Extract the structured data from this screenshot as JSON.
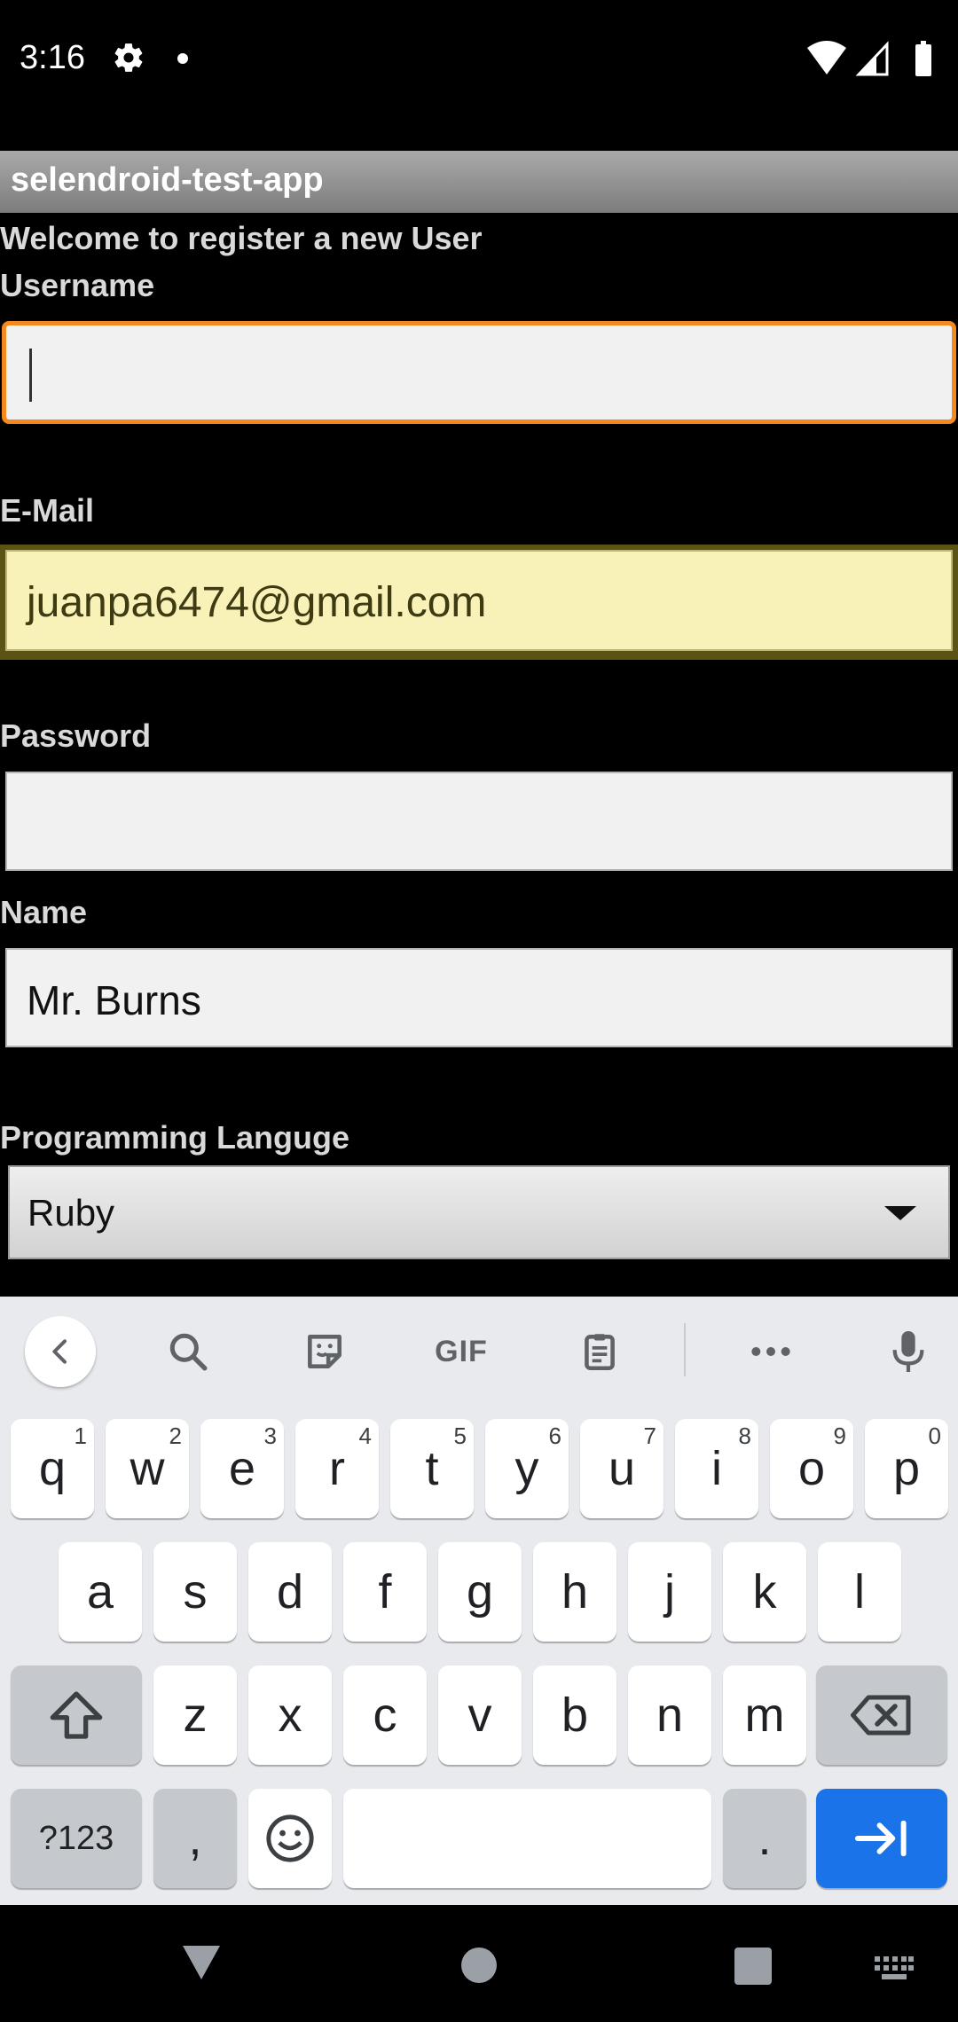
{
  "status_bar": {
    "time": "3:16",
    "icons": [
      "gear-icon",
      "notification-dot-icon",
      "wifi-icon",
      "signal-icon",
      "battery-icon"
    ]
  },
  "app": {
    "title": "selendroid-test-app",
    "welcome": "Welcome to register a new User"
  },
  "form": {
    "username_label": "Username",
    "username_value": "",
    "email_label": "E-Mail",
    "email_value": "juanpa6474@gmail.com",
    "password_label": "Password",
    "password_value": "",
    "name_label": "Name",
    "name_value": "Mr. Burns",
    "language_label": "Programming Languge",
    "language_value": "Ruby"
  },
  "keyboard": {
    "toolbar": [
      "back-icon",
      "search-icon",
      "sticker-icon",
      "GIF",
      "clipboard-icon",
      "more-icon",
      "mic-icon"
    ],
    "gif_label": "GIF",
    "row1": [
      {
        "k": "q",
        "h": "1"
      },
      {
        "k": "w",
        "h": "2"
      },
      {
        "k": "e",
        "h": "3"
      },
      {
        "k": "r",
        "h": "4"
      },
      {
        "k": "t",
        "h": "5"
      },
      {
        "k": "y",
        "h": "6"
      },
      {
        "k": "u",
        "h": "7"
      },
      {
        "k": "i",
        "h": "8"
      },
      {
        "k": "o",
        "h": "9"
      },
      {
        "k": "p",
        "h": "0"
      }
    ],
    "row2": [
      "a",
      "s",
      "d",
      "f",
      "g",
      "h",
      "j",
      "k",
      "l"
    ],
    "row3": [
      "z",
      "x",
      "c",
      "v",
      "b",
      "n",
      "m"
    ],
    "symbols_label": "?123",
    "comma": ",",
    "period": ".",
    "accent_color": "#1a73e8"
  },
  "nav_bar": {
    "buttons": [
      "back-triangle-icon",
      "home-circle-icon",
      "recents-square-icon",
      "keyboard-switch-icon"
    ]
  }
}
